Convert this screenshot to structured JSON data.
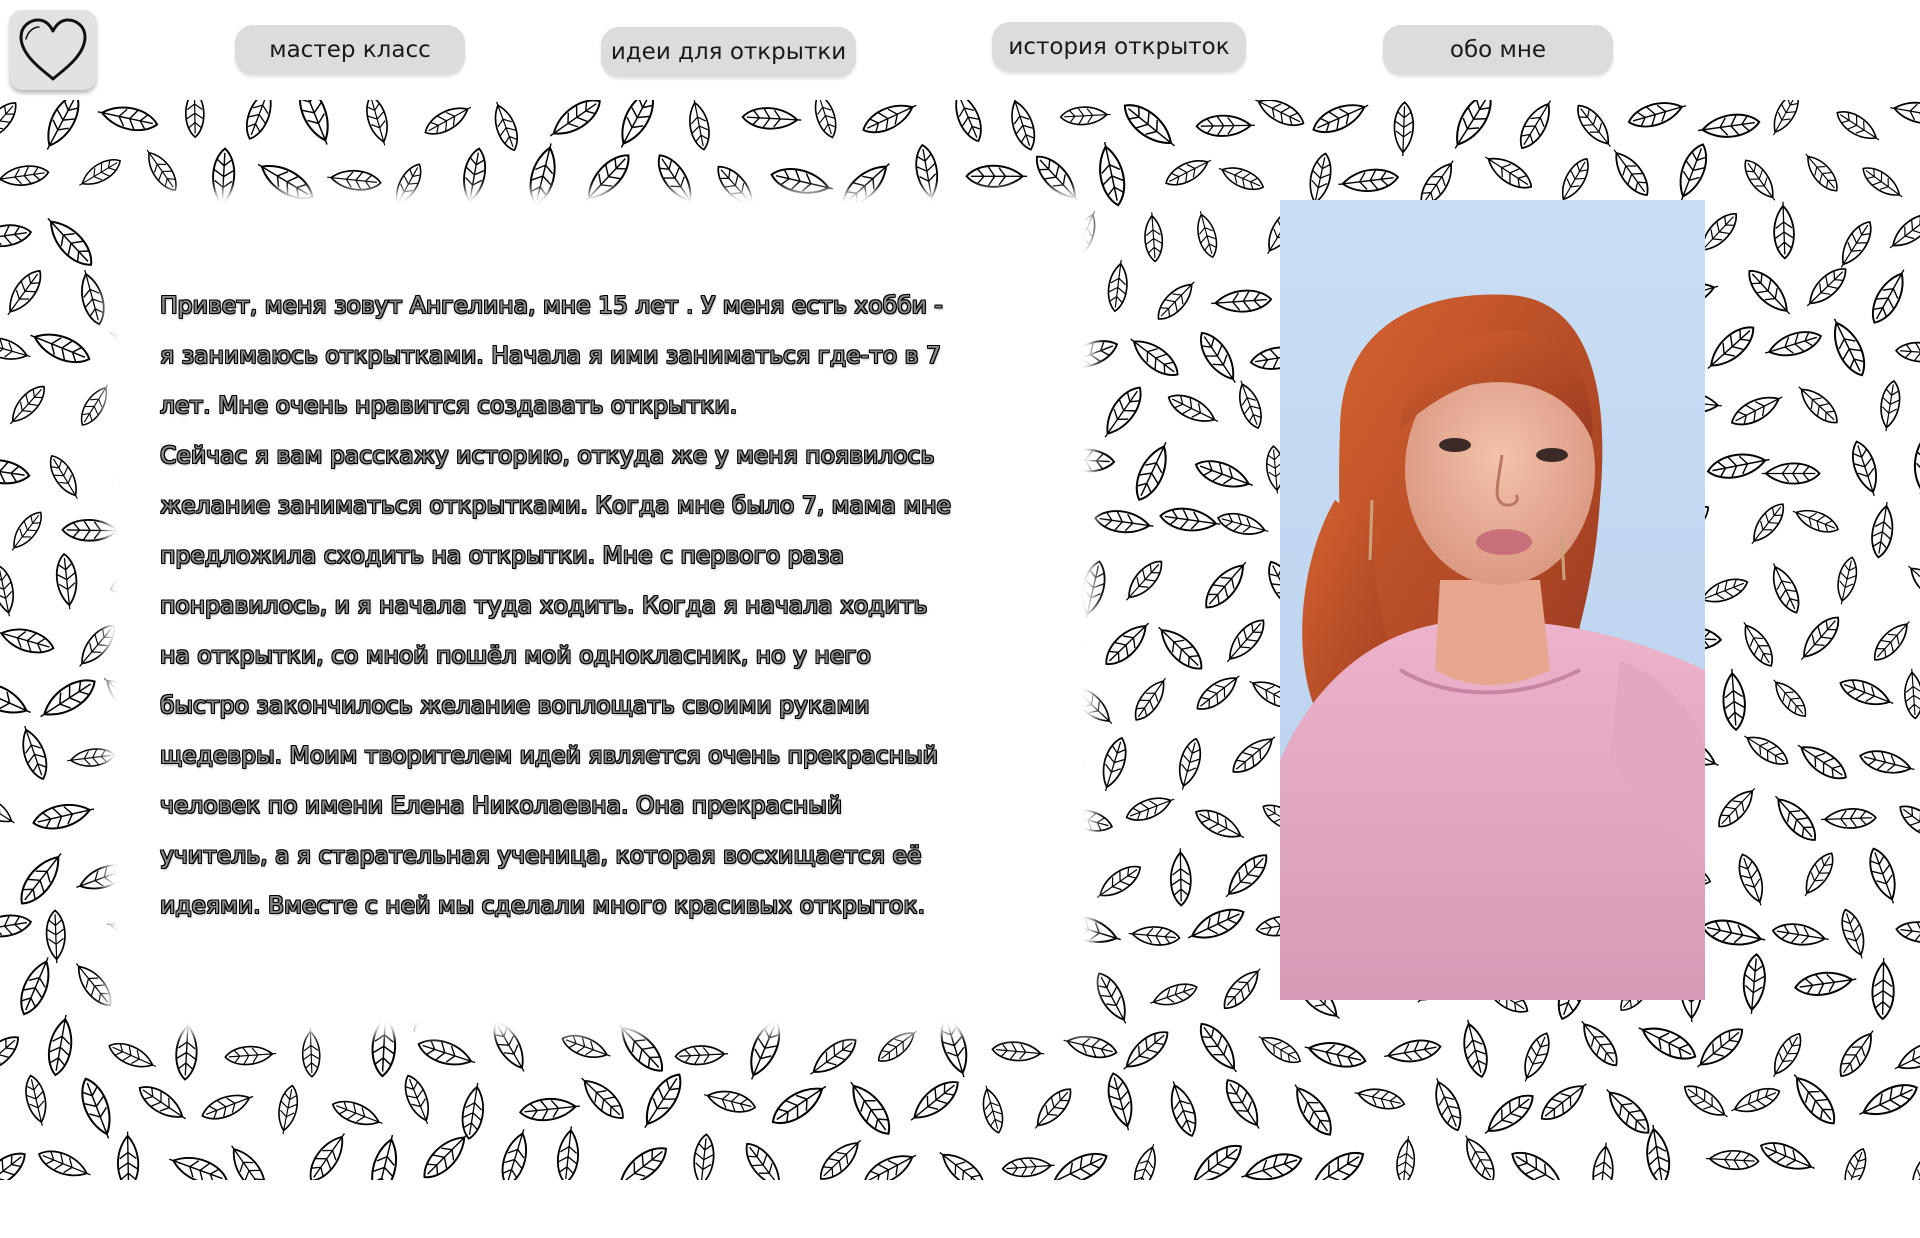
{
  "nav": {
    "logo_icon": "heart-icon",
    "items": [
      {
        "label": "мастер класс"
      },
      {
        "label": "идеи для открытки"
      },
      {
        "label": "история открыток"
      },
      {
        "label": "обо мне"
      }
    ]
  },
  "background": {
    "pattern_icon": "leaf-icon",
    "pattern_color": "#000000",
    "page_color": "#ffffff"
  },
  "story": {
    "lines": [
      "Привет, меня зовут Ангелина, мне  15 лет . У меня  есть хобби -",
      "я занимаюсь открытками. Начала я ими заниматься где-то в  7",
      "лет. Мне очень нравится создавать открытки.",
      "Сейчас я вам расскажу историю, откуда же у меня появилось",
      "желание заниматься открытками. Когда мне было 7, мама мне",
      "предложила сходить на открытки. Мне с первого раза",
      "понравилось, и я начала туда ходить. Когда я начала ходить",
      "на открытки, со мной пошёл мой однокласник, но у него",
      "быстро закончилось желание воплощать своими руками",
      "щедевры. Моим творителем идей является очень прекрасный",
      "человек по имени Елена Николаевна. Она прекрасный",
      "учитель, а я старательная ученица, которая восхищается её",
      "идеями. Вместе с ней мы сделали много красивых открыток."
    ],
    "text_fill": "#8c8c8c",
    "text_outline": "#000000"
  },
  "photo": {
    "subject": "portrait-photo",
    "sky_color": "#c9def4",
    "hair_color": "#c0502a",
    "sweater_color": "#e8aac4",
    "skin_color": "#f0b8a0"
  }
}
